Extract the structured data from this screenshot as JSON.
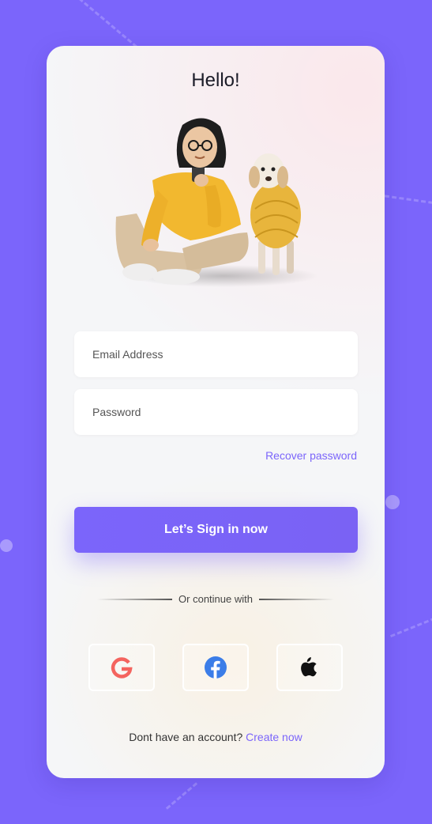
{
  "card": {
    "title": "Hello!"
  },
  "form": {
    "email_placeholder": "Email Address",
    "password_placeholder": "Password",
    "recover_label": "Recover password",
    "signin_label": "Let’s Sign in now"
  },
  "divider": {
    "label": "Or continue with"
  },
  "socials": [
    {
      "icon": "google-icon",
      "color": "#f4645f"
    },
    {
      "icon": "facebook-icon",
      "color": "#3b7de8"
    },
    {
      "icon": "apple-icon",
      "color": "#111111"
    }
  ],
  "footer": {
    "prompt": "Dont have an account?",
    "link_label": "Create now"
  },
  "colors": {
    "brand": "#7b65fb",
    "background": "#7b65fb",
    "card": "#f5f6f8"
  }
}
